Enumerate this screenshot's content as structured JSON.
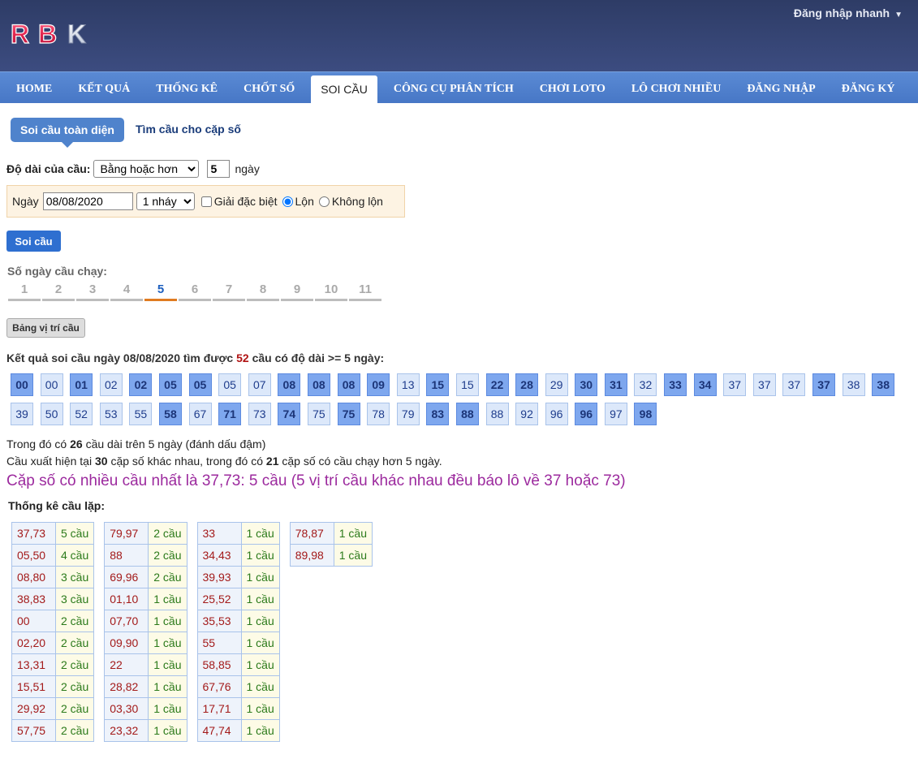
{
  "header": {
    "logo_text": "RBK",
    "login_quick": "Đăng nhập nhanh",
    "login_caret": "▼"
  },
  "nav": [
    "HOME",
    "KẾT QUẢ",
    "THỐNG KÊ",
    "CHỐT SỐ",
    "SOI CẦU",
    "CÔNG CỤ PHÂN TÍCH",
    "CHƠI LOTO",
    "LÔ CHƠI NHIỀU",
    "ĐĂNG NHẬP",
    "ĐĂNG KÝ"
  ],
  "nav_active": "SOI CẦU",
  "tabs": {
    "tab1": "Soi cầu toàn diện",
    "tab2": "Tìm cầu cho cặp số"
  },
  "form": {
    "length_label": "Độ dài của cầu:",
    "length_option": "Bằng hoặc hơn",
    "length_value": "5",
    "length_unit": "ngày",
    "date_label": "Ngày",
    "date_value": "08/08/2020",
    "nhay_option": "1 nháy",
    "special_label": "Giải đặc biệt",
    "lon_label": "Lộn",
    "khonglon_label": "Không lộn",
    "submit": "Soi cầu"
  },
  "days": {
    "title": "Số ngày cầu chạy:",
    "items": [
      "1",
      "2",
      "3",
      "4",
      "5",
      "6",
      "7",
      "8",
      "9",
      "10",
      "11"
    ],
    "active": "5"
  },
  "bang_button": "Bảng vị trí cầu",
  "result": {
    "prefix": "Kết quả soi cầu ngày 08/08/2020 tìm được",
    "count": "52",
    "suffix": "cầu có độ dài >= 5 ngày:"
  },
  "cells": [
    {
      "v": "00",
      "b": true
    },
    {
      "v": "00",
      "b": false
    },
    {
      "v": "01",
      "b": true
    },
    {
      "v": "02",
      "b": false
    },
    {
      "v": "02",
      "b": true
    },
    {
      "v": "05",
      "b": true
    },
    {
      "v": "05",
      "b": true
    },
    {
      "v": "05",
      "b": false
    },
    {
      "v": "07",
      "b": false
    },
    {
      "v": "08",
      "b": true
    },
    {
      "v": "08",
      "b": true
    },
    {
      "v": "08",
      "b": true
    },
    {
      "v": "09",
      "b": true
    },
    {
      "v": "13",
      "b": false
    },
    {
      "v": "15",
      "b": true
    },
    {
      "v": "15",
      "b": false
    },
    {
      "v": "22",
      "b": true
    },
    {
      "v": "28",
      "b": true
    },
    {
      "v": "29",
      "b": false
    },
    {
      "v": "30",
      "b": true
    },
    {
      "v": "31",
      "b": true
    },
    {
      "v": "32",
      "b": false
    },
    {
      "v": "33",
      "b": true
    },
    {
      "v": "34",
      "b": true
    },
    {
      "v": "37",
      "b": false
    },
    {
      "v": "37",
      "b": false
    },
    {
      "v": "37",
      "b": false
    },
    {
      "v": "37",
      "b": true
    },
    {
      "v": "38",
      "b": false
    },
    {
      "v": "38",
      "b": true
    },
    {
      "v": "39",
      "b": false
    },
    {
      "v": "50",
      "b": false
    },
    {
      "v": "52",
      "b": false
    },
    {
      "v": "53",
      "b": false
    },
    {
      "v": "55",
      "b": false
    },
    {
      "v": "58",
      "b": true
    },
    {
      "v": "67",
      "b": false
    },
    {
      "v": "71",
      "b": true
    },
    {
      "v": "73",
      "b": false
    },
    {
      "v": "74",
      "b": true
    },
    {
      "v": "75",
      "b": false
    },
    {
      "v": "75",
      "b": true
    },
    {
      "v": "78",
      "b": false
    },
    {
      "v": "79",
      "b": false
    },
    {
      "v": "83",
      "b": true
    },
    {
      "v": "88",
      "b": true
    },
    {
      "v": "88",
      "b": false
    },
    {
      "v": "92",
      "b": false
    },
    {
      "v": "96",
      "b": false
    },
    {
      "v": "96",
      "b": true
    },
    {
      "v": "97",
      "b": false
    },
    {
      "v": "98",
      "b": true
    }
  ],
  "info1": {
    "pre": "Trong đó có",
    "num": "26",
    "post": "cầu dài trên 5 ngày (đánh dấu đậm)"
  },
  "info2": {
    "pre": "Cầu xuất hiện tại",
    "num1": "30",
    "mid": "cặp số khác nhau, trong đó có",
    "num2": "21",
    "post": "cặp số có cầu chạy hơn 5 ngày."
  },
  "big_line": "Cặp số có nhiều cầu nhất là 37,73: 5 cầu (5 vị trí cầu khác nhau đều báo lô về 37 hoặc 73)",
  "repeat_title": "Thống kê cầu lặp:",
  "repeat_tables": [
    [
      [
        "37,73",
        "5 cầu"
      ],
      [
        "05,50",
        "4 cầu"
      ],
      [
        "08,80",
        "3 cầu"
      ],
      [
        "38,83",
        "3 cầu"
      ],
      [
        "00",
        "2 cầu"
      ],
      [
        "02,20",
        "2 cầu"
      ],
      [
        "13,31",
        "2 cầu"
      ],
      [
        "15,51",
        "2 cầu"
      ],
      [
        "29,92",
        "2 cầu"
      ],
      [
        "57,75",
        "2 cầu"
      ]
    ],
    [
      [
        "79,97",
        "2 cầu"
      ],
      [
        "88",
        "2 cầu"
      ],
      [
        "69,96",
        "2 cầu"
      ],
      [
        "01,10",
        "1 cầu"
      ],
      [
        "07,70",
        "1 cầu"
      ],
      [
        "09,90",
        "1 cầu"
      ],
      [
        "22",
        "1 cầu"
      ],
      [
        "28,82",
        "1 cầu"
      ],
      [
        "03,30",
        "1 cầu"
      ],
      [
        "23,32",
        "1 cầu"
      ]
    ],
    [
      [
        "33",
        "1 cầu"
      ],
      [
        "34,43",
        "1 cầu"
      ],
      [
        "39,93",
        "1 cầu"
      ],
      [
        "25,52",
        "1 cầu"
      ],
      [
        "35,53",
        "1 cầu"
      ],
      [
        "55",
        "1 cầu"
      ],
      [
        "58,85",
        "1 cầu"
      ],
      [
        "67,76",
        "1 cầu"
      ],
      [
        "17,71",
        "1 cầu"
      ],
      [
        "47,74",
        "1 cầu"
      ]
    ],
    [
      [
        "78,87",
        "1 cầu"
      ],
      [
        "89,98",
        "1 cầu"
      ]
    ]
  ]
}
